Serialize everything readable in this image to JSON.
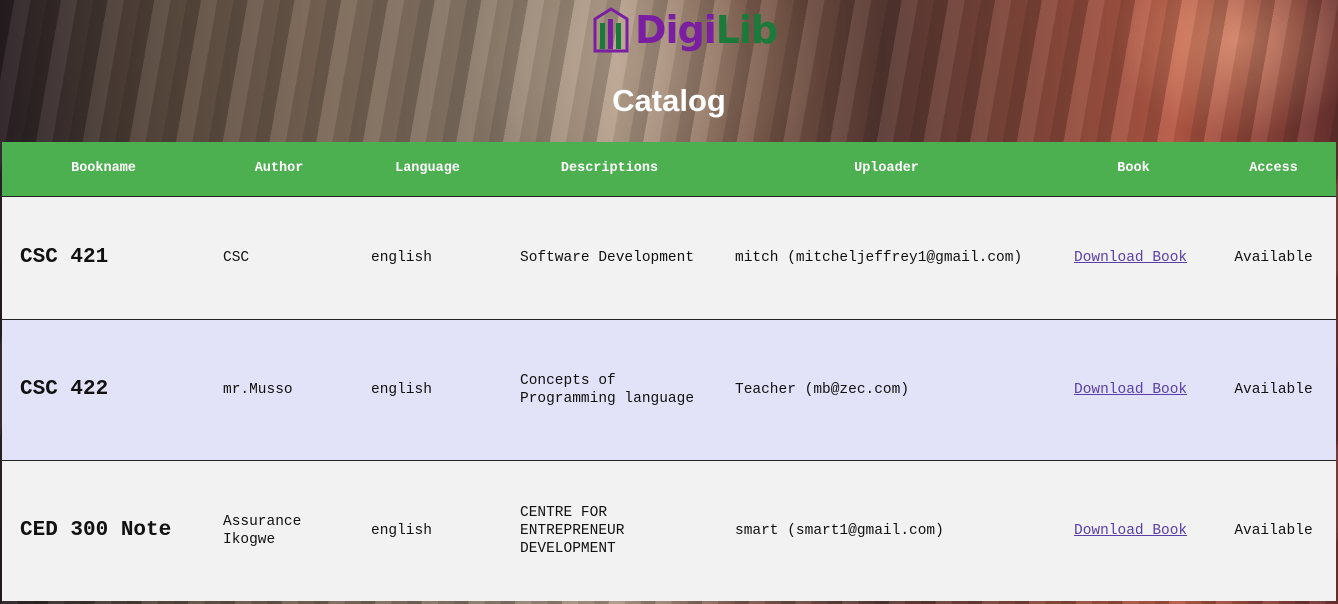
{
  "header": {
    "logo_part1": "Digi",
    "logo_part2": "Lib",
    "page_title": "Catalog"
  },
  "table": {
    "columns": [
      "Bookname",
      "Author",
      "Language",
      "Descriptions",
      "Uploader",
      "Book",
      "Access"
    ],
    "rows": [
      {
        "bookname": "CSC 421",
        "author": "CSC",
        "language": "english",
        "description": "Software Development",
        "uploader": "mitch (mitcheljeffrey1@gmail.com)",
        "book_link": "Download Book",
        "access": "Available"
      },
      {
        "bookname": "CSC 422",
        "author": "mr.Musso",
        "language": "english",
        "description": "Concepts of Programming language",
        "uploader": "Teacher (mb@zec.com)",
        "book_link": "Download Book",
        "access": "Available"
      },
      {
        "bookname": "CED 300 Note",
        "author": "Assurance Ikogwe",
        "language": "english",
        "description": "CENTRE FOR ENTREPRENEUR DEVELOPMENT",
        "uploader": "smart (smart1@gmail.com)",
        "book_link": "Download Book",
        "access": "Available"
      }
    ]
  },
  "colors": {
    "header_green": "#4caf50",
    "row_odd": "#f2f2f2",
    "row_even": "#e2e2f8",
    "link": "#5b3fa8",
    "logo_purple": "#7b1fa2",
    "logo_green": "#1b7a3a"
  }
}
